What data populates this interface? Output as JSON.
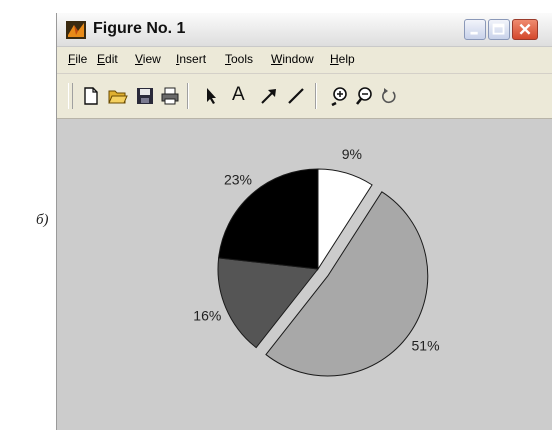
{
  "side_label": "б)",
  "window": {
    "title": "Figure No. 1",
    "menu": [
      "File",
      "Edit",
      "View",
      "Insert",
      "Tools",
      "Window",
      "Help"
    ],
    "toolbar_icons": [
      "new-file-icon",
      "open-folder-icon",
      "save-icon",
      "print-icon",
      "select-arrow-icon",
      "insert-text-icon",
      "insert-arrow-icon",
      "insert-line-icon",
      "zoom-in-icon",
      "zoom-out-icon",
      "rotate-icon"
    ],
    "toolbar_text_label": "A"
  },
  "chart_data": {
    "type": "pie",
    "title": "",
    "slices": [
      {
        "label": "9%",
        "value": 9,
        "color": "#ffffff",
        "exploded": false
      },
      {
        "label": "51%",
        "value": 51,
        "color": "#a8a8a8",
        "exploded": true
      },
      {
        "label": "16%",
        "value": 16,
        "color": "#555555",
        "exploded": false
      },
      {
        "label": "23%",
        "value": 23,
        "color": "#000000",
        "exploded": false
      }
    ],
    "start_angle_deg": -90,
    "direction": "clockwise",
    "background": "#cccccc"
  }
}
